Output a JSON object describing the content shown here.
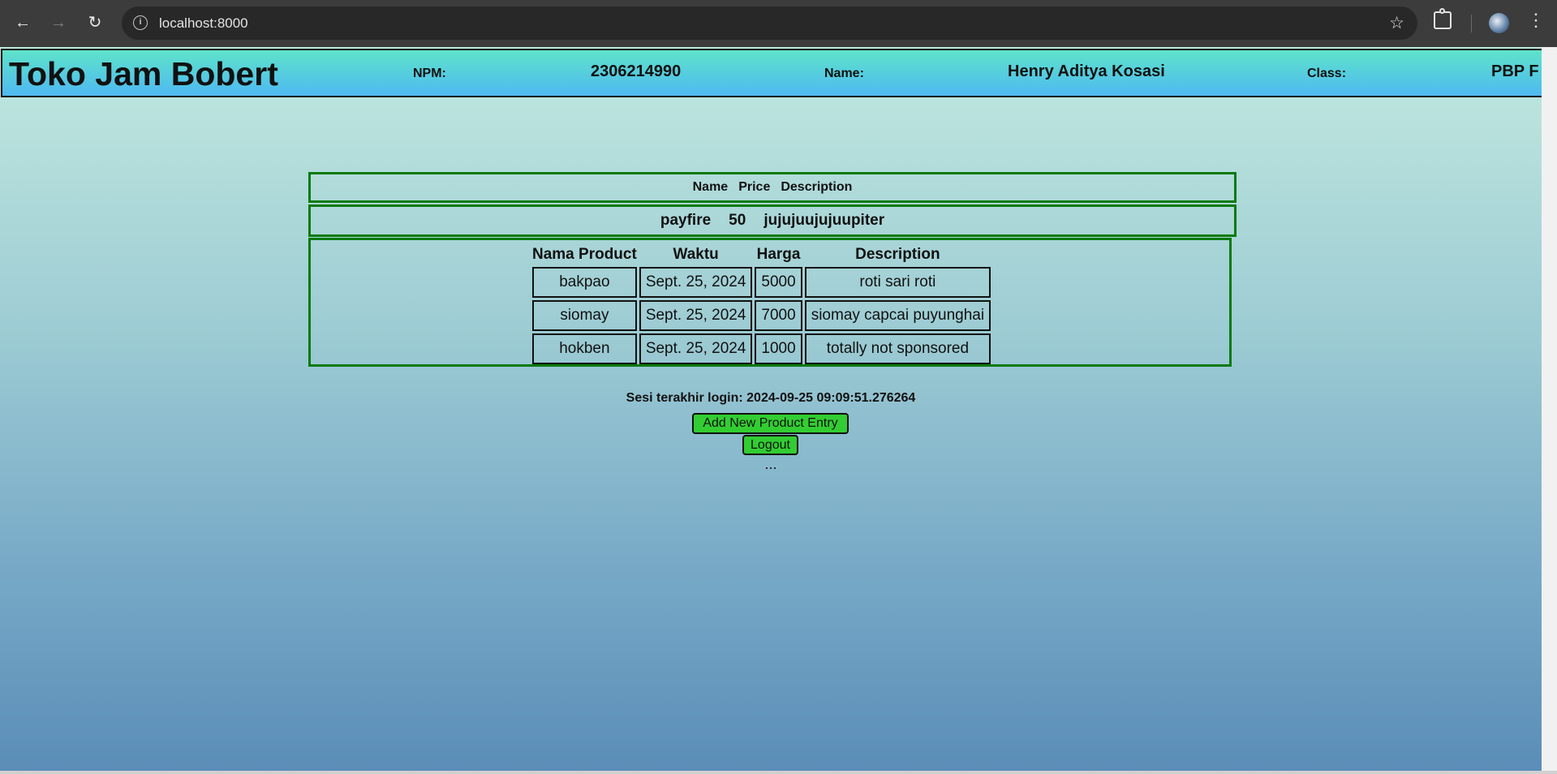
{
  "browser": {
    "url": "localhost:8000",
    "icons": {
      "back": "back-arrow-icon",
      "forward": "forward-arrow-icon",
      "reload": "reload-icon",
      "info": "site-info-icon",
      "bookmark": "star-icon",
      "extensions": "puzzle-icon",
      "menu": "kebab-menu-icon"
    }
  },
  "header": {
    "title": "Toko Jam Bobert",
    "npm_label": "NPM:",
    "npm_value": "2306214990",
    "name_label": "Name:",
    "name_value": "Henry Aditya Kosasi",
    "class_label": "Class:",
    "class_value": "PBP F"
  },
  "summary": {
    "headers": [
      "Name",
      "Price",
      "Description"
    ],
    "row": [
      "payfire",
      "50",
      "jujujuujujuupiter"
    ]
  },
  "products": {
    "columns": [
      "Nama Product",
      "Waktu",
      "Harga",
      "Description"
    ],
    "rows": [
      [
        "bakpao",
        "Sept. 25, 2024",
        "5000",
        "roti sari roti"
      ],
      [
        "siomay",
        "Sept. 25, 2024",
        "7000",
        "siomay capcai puyunghai"
      ],
      [
        "hokben",
        "Sept. 25, 2024",
        "1000",
        "totally not sponsored"
      ]
    ]
  },
  "session": {
    "last_login": "Sesi terakhir login: 2024-09-25 09:09:51.276264"
  },
  "actions": {
    "add_label": "Add New Product Entry",
    "logout_label": "Logout",
    "ellipsis": "..."
  },
  "colors": {
    "header_gradient_top": "#5ee3c9",
    "header_gradient_bottom": "#4eb9f2",
    "box_border": "#0a7a0a",
    "button_bg": "#32cd32"
  }
}
